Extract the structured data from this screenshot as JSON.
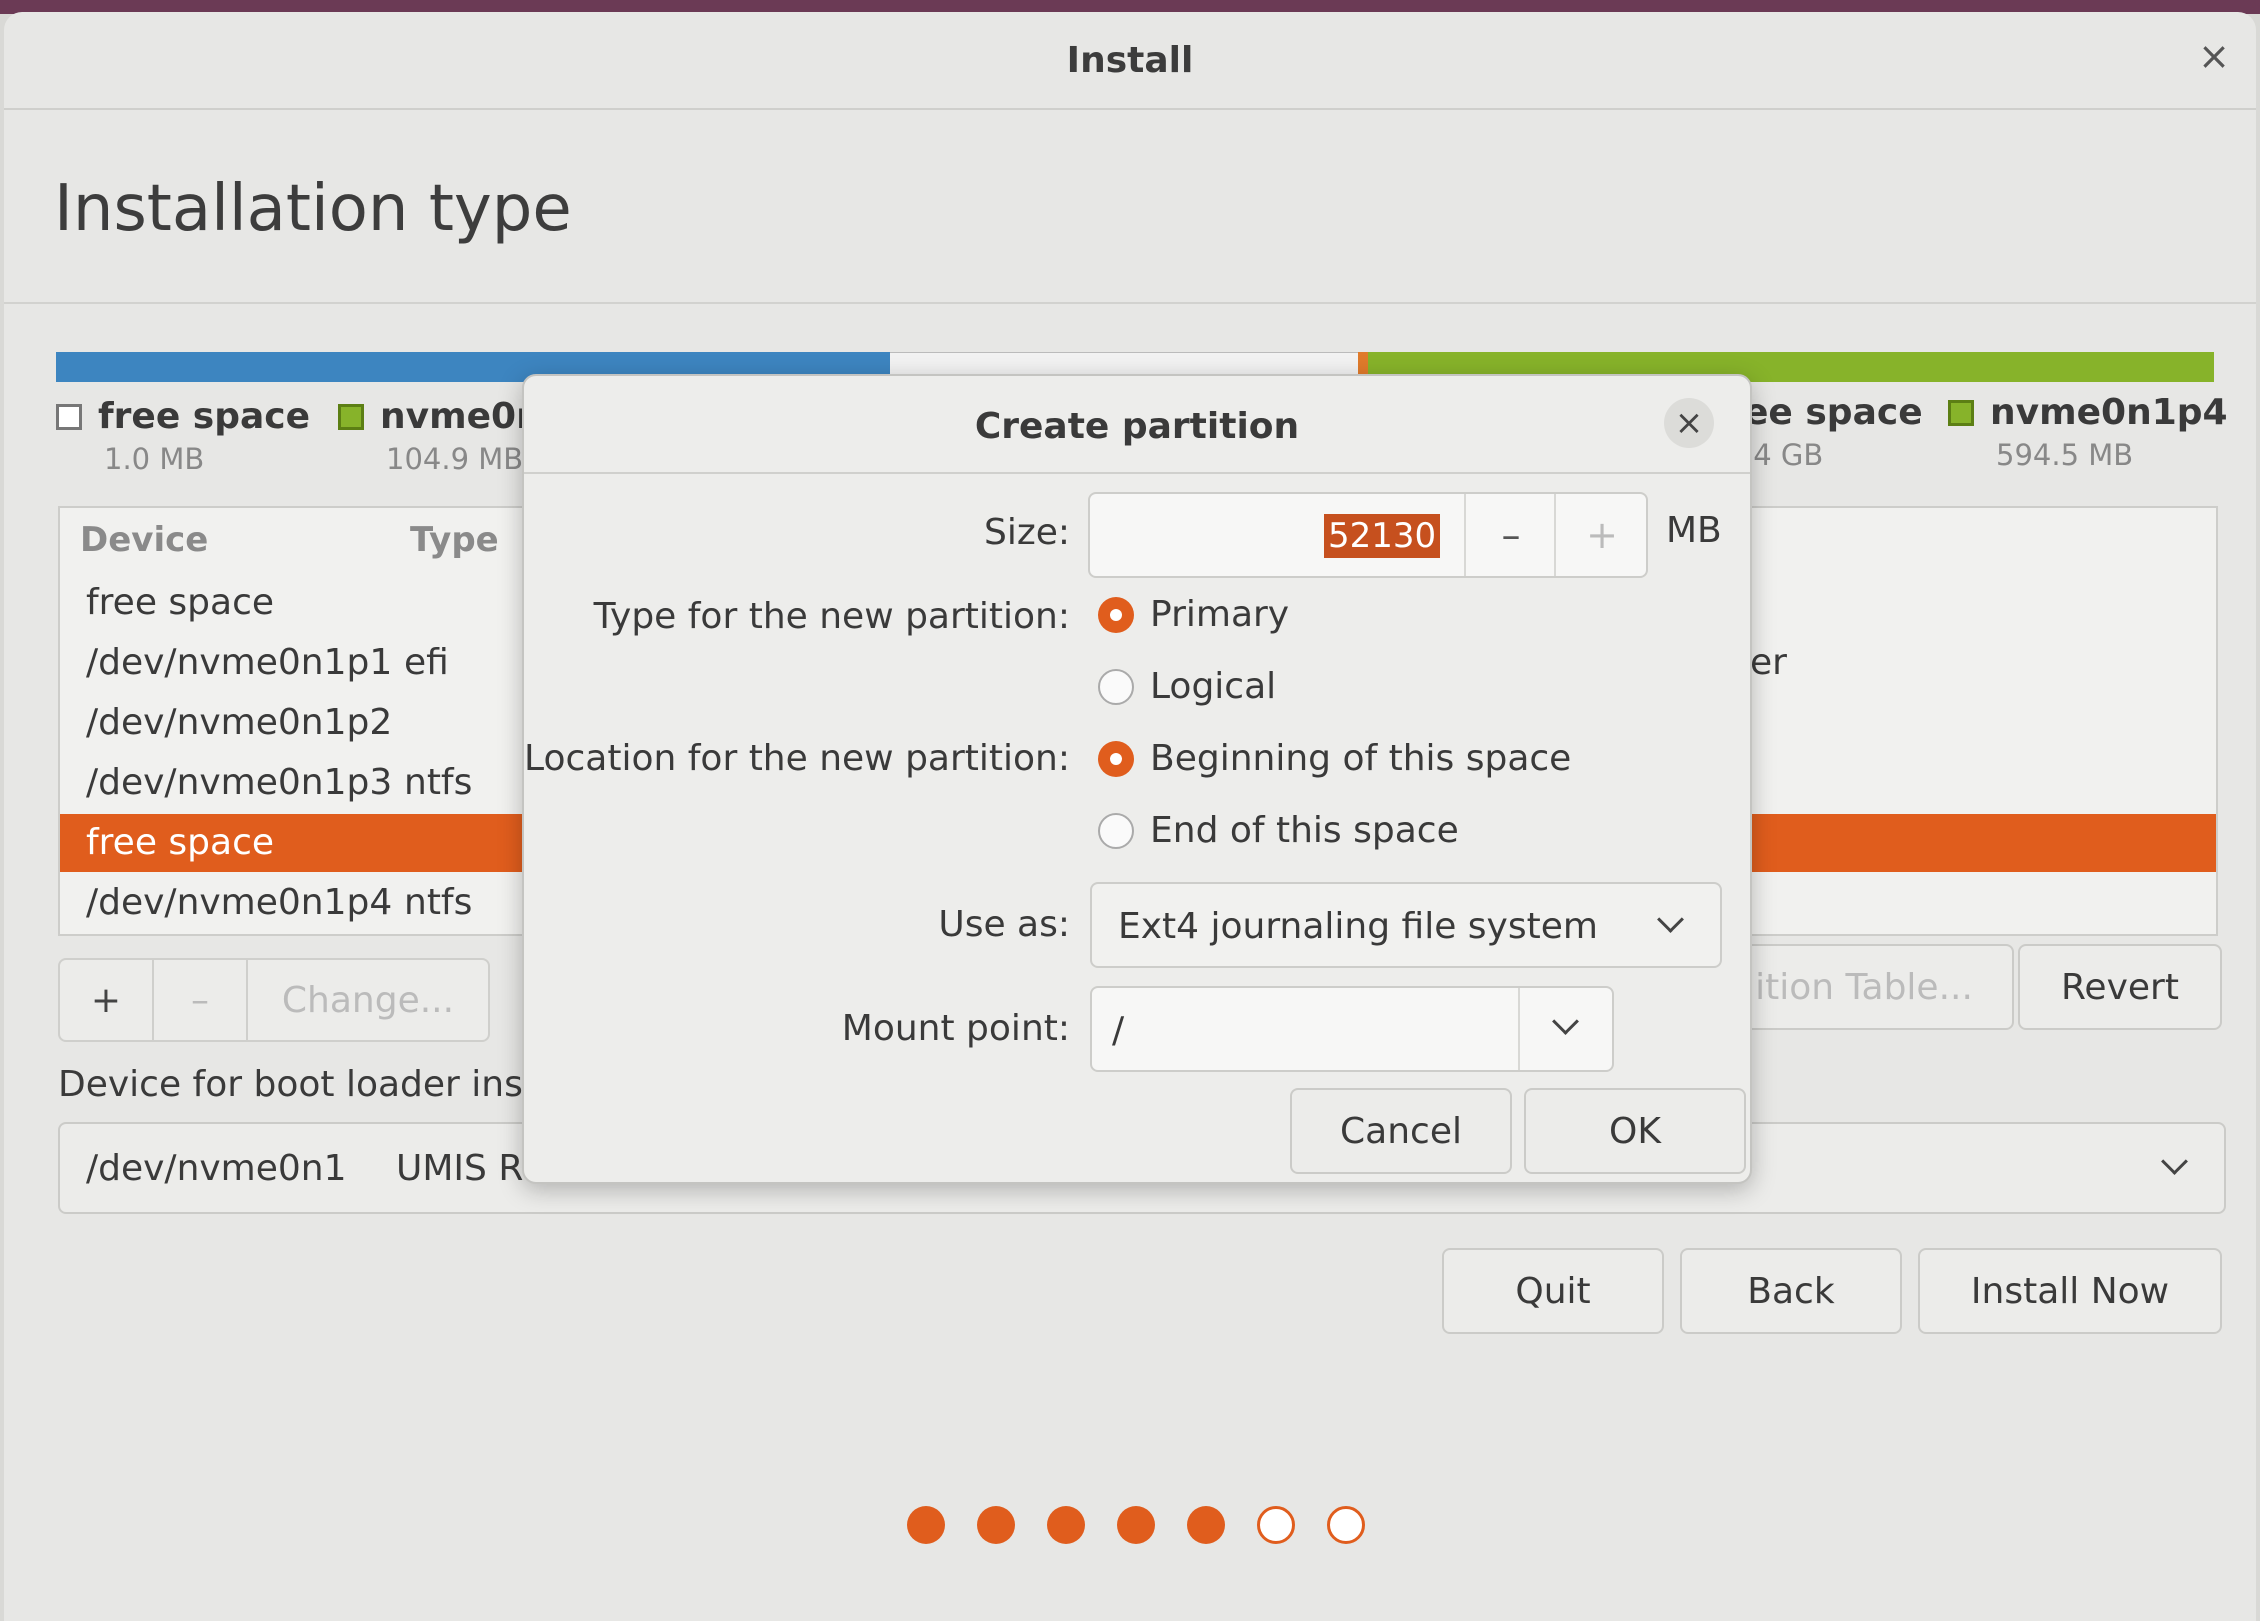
{
  "window": {
    "title": "Install",
    "close": "×"
  },
  "page": {
    "heading": "Installation type"
  },
  "partition_bar": {
    "legend_left": [
      {
        "name": "free space",
        "size": "1.0 MB"
      },
      {
        "name": "nvme0n",
        "size": "104.9 MB"
      }
    ],
    "legend_right": [
      {
        "name": "ee space",
        "size": ".4 GB"
      },
      {
        "name": "nvme0n1p4",
        "size": "594.5 MB"
      }
    ]
  },
  "table": {
    "headers": {
      "device": "Device",
      "type": "Type"
    },
    "rows": [
      {
        "device": "free space",
        "type": "",
        "right": ""
      },
      {
        "device": "/dev/nvme0n1p1",
        "type": "efi",
        "right": "er"
      },
      {
        "device": "/dev/nvme0n1p2",
        "type": "",
        "right": ""
      },
      {
        "device": "/dev/nvme0n1p3",
        "type": "ntfs",
        "right": ""
      },
      {
        "device": "free space",
        "type": "",
        "right": "",
        "selected": true
      },
      {
        "device": "/dev/nvme0n1p4",
        "type": "ntfs",
        "right": ""
      }
    ]
  },
  "toolbar": {
    "add": "+",
    "remove": "–",
    "change": "Change...",
    "new_table": "ition Table...",
    "revert": "Revert"
  },
  "bootloader": {
    "label": "Device for boot loader inst",
    "device": "/dev/nvme0n1",
    "model": "UMIS RI"
  },
  "nav": {
    "quit": "Quit",
    "back": "Back",
    "install_now": "Install Now"
  },
  "progress": {
    "total_steps": 7,
    "completed_steps": 5
  },
  "dialog": {
    "title": "Create partition",
    "close": "×",
    "size_label": "Size:",
    "size_value": "52130",
    "size_unit": "MB",
    "minus": "–",
    "plus": "+",
    "type_label": "Type for the new partition:",
    "type_primary": "Primary",
    "type_logical": "Logical",
    "location_label": "Location for the new partition:",
    "location_beginning": "Beginning of this space",
    "location_end": "End of this space",
    "use_as_label": "Use as:",
    "use_as_value": "Ext4 journaling file system",
    "mount_label": "Mount point:",
    "mount_value": "/",
    "cancel": "Cancel",
    "ok": "OK"
  },
  "colors": {
    "accent": "#e05d1d",
    "bar_blue": "#3d85c0",
    "bar_green": "#87b32a"
  }
}
